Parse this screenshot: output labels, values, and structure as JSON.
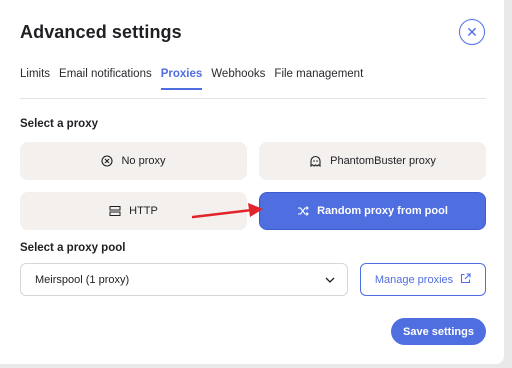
{
  "modal": {
    "title": "Advanced settings",
    "close_icon": "close-icon"
  },
  "tabs": [
    {
      "label": "Limits",
      "active": false
    },
    {
      "label": "Email notifications",
      "active": false
    },
    {
      "label": "Proxies",
      "active": true
    },
    {
      "label": "Webhooks",
      "active": false
    },
    {
      "label": "File management",
      "active": false
    }
  ],
  "proxy_section": {
    "label": "Select a proxy",
    "options": [
      {
        "label": "No proxy",
        "icon": "x-circle-icon",
        "selected": false
      },
      {
        "label": "PhantomBuster proxy",
        "icon": "ghost-icon",
        "selected": false
      },
      {
        "label": "HTTP",
        "icon": "server-icon",
        "selected": false
      },
      {
        "label": "Random proxy from pool",
        "icon": "shuffle-icon",
        "selected": true
      }
    ]
  },
  "pool_section": {
    "label": "Select a proxy pool",
    "selected_value": "Meirspool (1 proxy)",
    "manage_label": "Manage proxies"
  },
  "footer": {
    "save_label": "Save settings"
  },
  "colors": {
    "accent": "#4f6ee0",
    "option_bg": "#f3f0ed",
    "annotation_arrow": "#e0252b"
  }
}
